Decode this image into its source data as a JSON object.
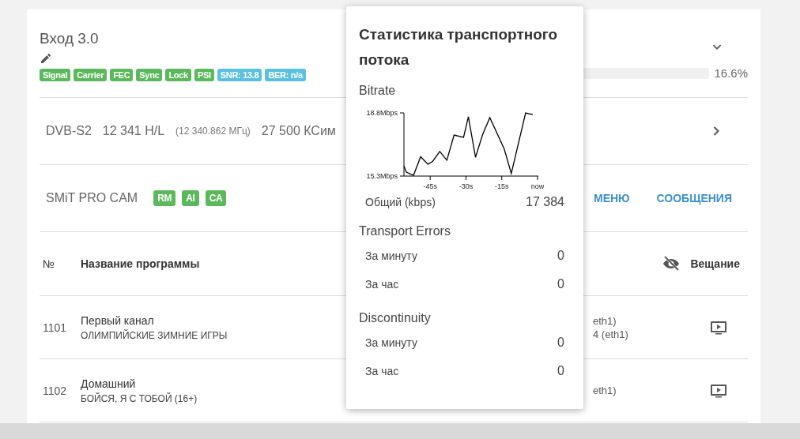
{
  "input": {
    "title": "Вход 3.0",
    "badges": [
      {
        "label": "Signal",
        "color": "#5cb85c"
      },
      {
        "label": "Carrier",
        "color": "#5cb85c"
      },
      {
        "label": "FEC",
        "color": "#5cb85c"
      },
      {
        "label": "Sync",
        "color": "#5cb85c"
      },
      {
        "label": "Lock",
        "color": "#5cb85c"
      },
      {
        "label": "PSI",
        "color": "#5cb85c"
      },
      {
        "label": "SNR: 13.8",
        "color": "#5bc0de"
      },
      {
        "label": "BER: n/a",
        "color": "#5bc0de"
      }
    ],
    "load": "16.6%"
  },
  "tuning": {
    "standard": "DVB-S2",
    "frequency": "12 341 H/L",
    "exact_frequency": "(12 340.862 МГц)",
    "symbol_rate": "27 500 КСим"
  },
  "cam": {
    "name": "SMiT PRO CAM",
    "badges": [
      {
        "label": "RM",
        "color": "#5cb85c"
      },
      {
        "label": "AI",
        "color": "#5cb85c"
      },
      {
        "label": "CA",
        "color": "#5cb85c"
      }
    ],
    "buttons": [
      "МЕНЮ",
      "СООБЩЕНИЯ"
    ]
  },
  "table": {
    "columns": {
      "number": "№",
      "name": "Название программы",
      "broadcast": "Вещание"
    },
    "rows": [
      {
        "number": "1101",
        "name": "Первый канал",
        "event": "ОЛИМПИЙСКИЕ ЗИМНИЕ ИГРЫ",
        "outputs": [
          "eth1)",
          "4 (eth1)"
        ]
      },
      {
        "number": "1102",
        "name": "Домашний",
        "event": "БОЙСЯ, Я С ТОБОЙ (16+)",
        "outputs": [
          "eth1)"
        ]
      }
    ]
  },
  "stats_popup": {
    "title": "Статистика транспортного потока",
    "bitrate": {
      "heading": "Bitrate",
      "chart_data": {
        "type": "line",
        "x": [
          -56,
          -55,
          -52,
          -49,
          -46,
          -44,
          -41,
          -38,
          -35,
          -31,
          -29,
          -26,
          -23,
          -20,
          -14,
          -11,
          -5,
          -2
        ],
        "series": [
          {
            "color": "#000000",
            "values": [
              15.86,
              15.52,
              15.34,
              16.37,
              15.96,
              16.11,
              16.66,
              16.18,
              17.57,
              17.45,
              18.59,
              16.34,
              17.61,
              18.54,
              16.81,
              15.45,
              18.8,
              18.71
            ]
          }
        ],
        "xlim": [
          -56,
          0
        ],
        "ylim": [
          15.3,
          18.8
        ],
        "xticks": [
          {
            "value": -45,
            "label": "-45s"
          },
          {
            "value": -30,
            "label": "-30s"
          },
          {
            "value": -15,
            "label": "-15s"
          },
          {
            "value": 0,
            "label": "now"
          }
        ],
        "yticks": [
          {
            "value": 15.3,
            "label": "15.3Mbps"
          },
          {
            "value": 18.8,
            "label": "18.8Mbps"
          }
        ]
      },
      "total_label": "Общий (kbps)",
      "total_value": "17 384"
    },
    "sections": [
      {
        "heading": "Transport Errors",
        "rows": [
          {
            "label": "За минуту",
            "value": "0"
          },
          {
            "label": "За час",
            "value": "0"
          }
        ]
      },
      {
        "heading": "Discontinuity",
        "rows": [
          {
            "label": "За минуту",
            "value": "0"
          },
          {
            "label": "За час",
            "value": "0"
          }
        ]
      }
    ]
  }
}
